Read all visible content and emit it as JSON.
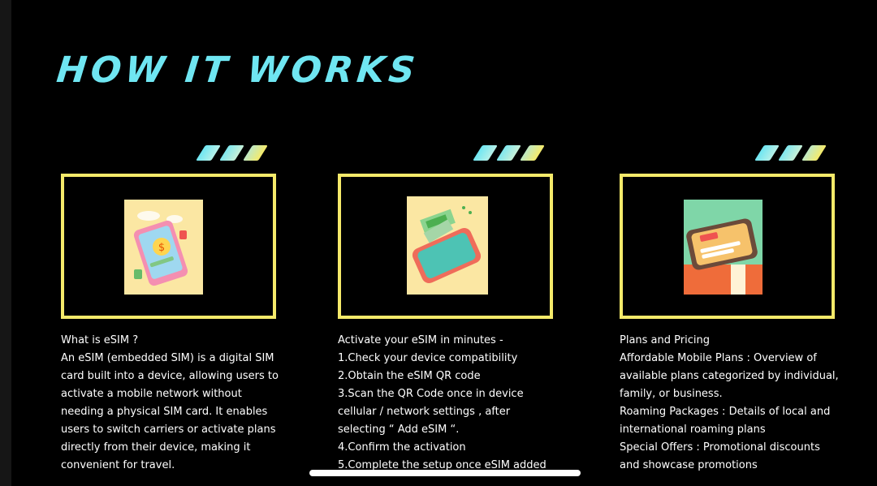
{
  "header": {
    "title": "HOW IT WORKS"
  },
  "colors": {
    "title": "#6fe6f2",
    "frame_border": "#f5ea6a",
    "stripe_start": "#6fe6f2",
    "stripe_end": "#f5ea6a"
  },
  "cards": [
    {
      "heading": "What is eSIM ?",
      "lines": [
        "An eSIM (embedded SIM) is a digital SIM",
        "card built into a device, allowing users to",
        "activate a mobile network without",
        "needing a physical SIM card. It enables",
        "users to switch carriers or activate plans",
        "directly from their device, making it",
        "convenient for travel."
      ]
    },
    {
      "heading": "Activate your eSIM in minutes -",
      "lines": [
        "1.Check your device compatibility",
        "2.Obtain the eSIM QR code",
        "3.Scan the QR Code once in device",
        "cellular / network settings , after",
        "selecting “ Add eSIM “.",
        "4.Confirm the activation",
        "5.Complete the setup once eSIM added"
      ]
    },
    {
      "heading": "Plans and Pricing",
      "lines": [
        "Affordable Mobile Plans : Overview of",
        "available plans categorized by individual,",
        "family, or business.",
        "Roaming Packages : Details of local and",
        "international roaming plans",
        "Special Offers : Promotional discounts",
        "and showcase promotions"
      ]
    }
  ]
}
